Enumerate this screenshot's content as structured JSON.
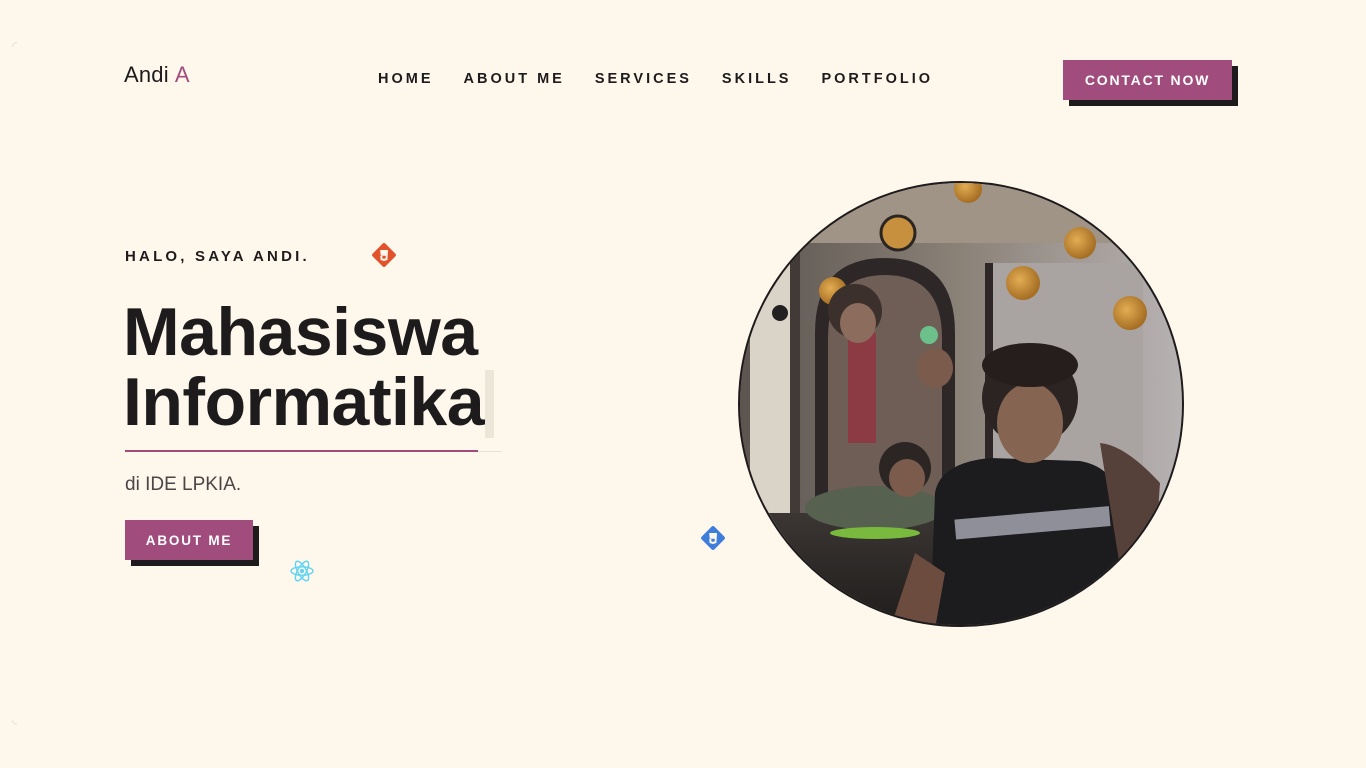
{
  "header": {
    "logo": {
      "name": "Andi",
      "accent": "A"
    },
    "nav": [
      "HOME",
      "ABOUT ME",
      "SERVICES",
      "SKILLS",
      "PORTFOLIO"
    ],
    "cta_label": "CONTACT NOW"
  },
  "hero": {
    "greeting": "HALO, SAYA ANDI.",
    "headline_line1": "Mahasiswa",
    "headline_line2": "Informatika",
    "subtitle": "di IDE LPKIA.",
    "button_label": "ABOUT ME"
  },
  "icons": {
    "html": "html5-icon",
    "css": "css3-icon",
    "react": "react-icon"
  },
  "colors": {
    "background": "#fef8ec",
    "accent": "#a04c7c",
    "text": "#1d1b1c",
    "shadow": "#1d1b1c"
  }
}
